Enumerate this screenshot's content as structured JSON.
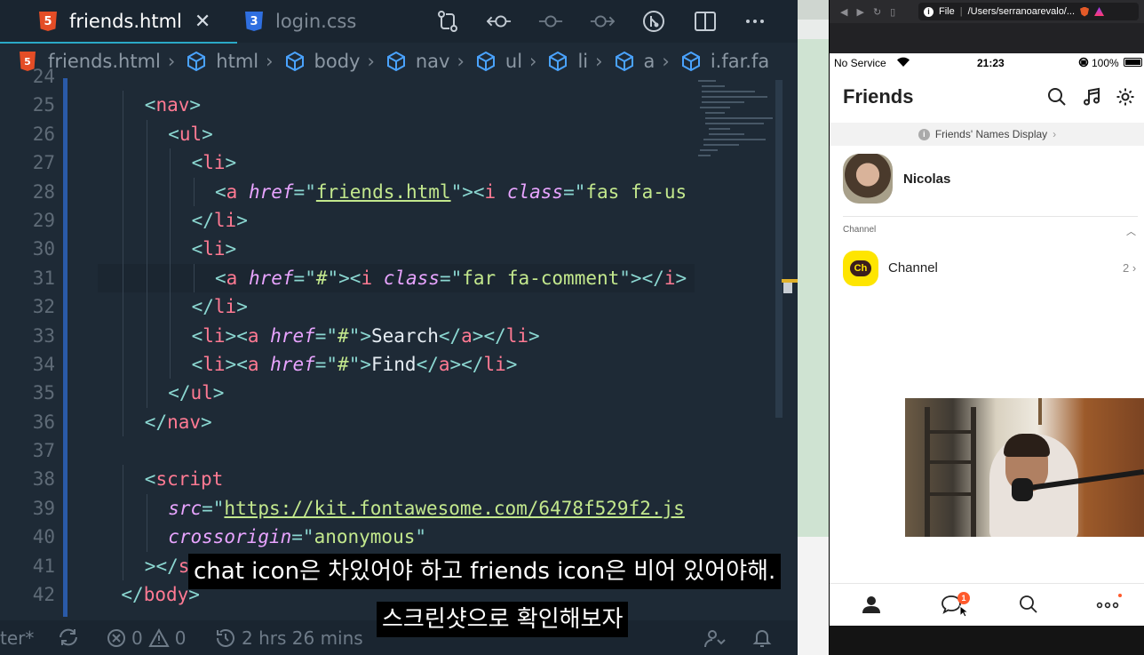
{
  "editor": {
    "tabs": [
      {
        "label": "friends.html",
        "icon": "html5-icon",
        "active": true,
        "close": "✕"
      },
      {
        "label": "login.css",
        "icon": "css3-icon",
        "active": false
      }
    ],
    "breadcrumb": [
      "friends.html",
      "html",
      "body",
      "nav",
      "ul",
      "li",
      "a",
      "i.far.fa"
    ],
    "lines": [
      {
        "n": "24",
        "indent": 0,
        "html": ""
      },
      {
        "n": "25",
        "indent": 2,
        "html": "<span class='pun'>&lt;</span><span class='tag'>nav</span><span class='pun'>&gt;</span>"
      },
      {
        "n": "26",
        "indent": 3,
        "html": "<span class='pun'>&lt;</span><span class='tag'>ul</span><span class='pun'>&gt;</span>"
      },
      {
        "n": "27",
        "indent": 4,
        "html": "<span class='pun'>&lt;</span><span class='tag'>li</span><span class='pun'>&gt;</span>"
      },
      {
        "n": "28",
        "indent": 5,
        "html": "<span class='pun'>&lt;</span><span class='tag'>a</span> <span class='attr'>href</span><span class='pun'>=</span><span class='pun'>\"</span><span class='str' style='text-decoration:underline'>friends.html</span><span class='pun'>\"</span><span class='pun'>&gt;&lt;</span><span class='tag'>i</span> <span class='attr'>class</span><span class='pun'>=</span><span class='pun'>\"</span><span class='str'>fas fa-us</span>"
      },
      {
        "n": "29",
        "indent": 4,
        "html": "<span class='pun'>&lt;/</span><span class='tag'>li</span><span class='pun'>&gt;</span>"
      },
      {
        "n": "30",
        "indent": 4,
        "html": "<span class='pun'>&lt;</span><span class='tag'>li</span><span class='pun'>&gt;</span>"
      },
      {
        "n": "31",
        "indent": 5,
        "active": true,
        "html": "<span class='pun'>&lt;</span><span class='tag'>a</span> <span class='attr'>href</span><span class='pun'>=\"</span><span class='str'>#</span><span class='pun'>\"&gt;&lt;</span><span class='tag'>i</span> <span class='attr'>class</span><span class='pun'>=\"</span><span class='str'>far fa-comment</span><span class='pun'>\"&gt;&lt;/</span><span class='tag'>i</span><span class='pun'>&gt;</span>"
      },
      {
        "n": "32",
        "indent": 4,
        "html": "<span class='pun'>&lt;/</span><span class='tag'>li</span><span class='pun'>&gt;</span>"
      },
      {
        "n": "33",
        "indent": 4,
        "html": "<span class='pun'>&lt;</span><span class='tag'>li</span><span class='pun'>&gt;&lt;</span><span class='tag'>a</span> <span class='attr'>href</span><span class='pun'>=\"</span><span class='str'>#</span><span class='pun'>\"&gt;</span><span class='txt'>Search</span><span class='pun'>&lt;/</span><span class='tag'>a</span><span class='pun'>&gt;&lt;/</span><span class='tag'>li</span><span class='pun'>&gt;</span>"
      },
      {
        "n": "34",
        "indent": 4,
        "html": "<span class='pun'>&lt;</span><span class='tag'>li</span><span class='pun'>&gt;&lt;</span><span class='tag'>a</span> <span class='attr'>href</span><span class='pun'>=\"</span><span class='str'>#</span><span class='pun'>\"&gt;</span><span class='txt'>Find</span><span class='pun'>&lt;/</span><span class='tag'>a</span><span class='pun'>&gt;&lt;/</span><span class='tag'>li</span><span class='pun'>&gt;</span>"
      },
      {
        "n": "35",
        "indent": 3,
        "html": "<span class='pun'>&lt;/</span><span class='tag'>ul</span><span class='pun'>&gt;</span>"
      },
      {
        "n": "36",
        "indent": 2,
        "html": "<span class='pun'>&lt;/</span><span class='tag'>nav</span><span class='pun'>&gt;</span>"
      },
      {
        "n": "37",
        "indent": 0,
        "html": ""
      },
      {
        "n": "38",
        "indent": 2,
        "html": "<span class='pun'>&lt;</span><span class='tag'>script</span>"
      },
      {
        "n": "39",
        "indent": 3,
        "html": "<span class='attr'>src</span><span class='pun'>=\"</span><span class='str' style='text-decoration:underline'>https://kit.fontawesome.com/6478f529f2.js</span>"
      },
      {
        "n": "40",
        "indent": 3,
        "html": "<span class='attr'>crossorigin</span><span class='pun'>=\"</span><span class='str'>anonymous</span><span class='pun'>\"</span>"
      },
      {
        "n": "41",
        "indent": 2,
        "html": "<span class='pun'>&gt;&lt;/</span><span class='tag'>s</span>"
      },
      {
        "n": "42",
        "indent": 1,
        "html": "<span class='pun'>&lt;/</span><span class='tag'>body</span><span class='pun'>&gt;</span>"
      }
    ],
    "status": {
      "left_label": "ter*",
      "errors": "0",
      "warnings": "0",
      "time": "2 hrs 26 mins"
    }
  },
  "browser": {
    "url_scheme": "File",
    "url": "/Users/serranoarevalo/...",
    "ios_status": {
      "carrier": "No Service",
      "time": "21:23",
      "battery": "100%"
    },
    "app_title": "Friends",
    "names_display": "Friends' Names Display",
    "profile_name": "Nicolas",
    "section_label": "Channel",
    "channel_label": "Channel",
    "channel_logo": "Ch",
    "channel_count": "2",
    "badge_count": "1"
  },
  "subtitles": {
    "line1": "chat icon은 차있어야 하고 friends icon은 비어 있어야해.",
    "line2": "스크린샷으로 확인해보자"
  },
  "colors": {
    "editor_bg": "#1e2a36",
    "html_tag": "#ff7a93",
    "attribute": "#e8a4ff",
    "string": "#c3e88d",
    "kakao_yellow": "#fee500",
    "badge": "#ff5a2c"
  }
}
